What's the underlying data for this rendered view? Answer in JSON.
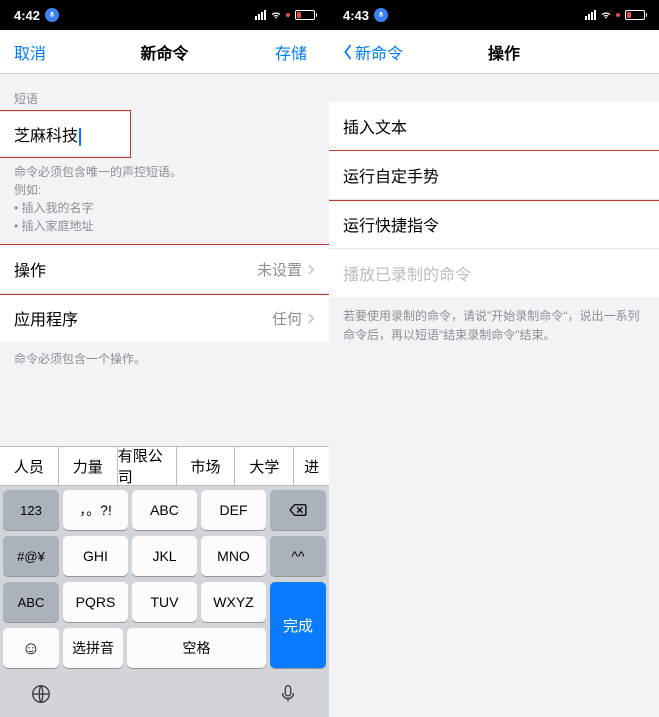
{
  "left": {
    "status": {
      "time": "4:42"
    },
    "nav": {
      "cancel": "取消",
      "title": "新命令",
      "save": "存储"
    },
    "section_label": "短语",
    "input_value": "芝麻科技",
    "help": {
      "line1": "命令必须包含唯一的声控短语。",
      "line2": "例如:",
      "bullet1": "• 插入我的名字",
      "bullet2": "• 插入家庭地址"
    },
    "rows": {
      "action": {
        "label": "操作",
        "value": "未设置"
      },
      "app": {
        "label": "应用程序",
        "value": "任何"
      }
    },
    "footer": "命令必须包含一个操作。",
    "keyboard": {
      "suggestions": [
        "人员",
        "力量",
        "有限公司",
        "市场",
        "大学",
        "进"
      ],
      "r1": {
        "k1": "123",
        "k2": "，。?!",
        "k3": "ABC",
        "k4": "DEF"
      },
      "r2": {
        "k1": "#@¥",
        "k2": "GHI",
        "k3": "JKL",
        "k4": "MNO",
        "k5": "^^"
      },
      "r3": {
        "k1": "ABC",
        "k2": "PQRS",
        "k3": "TUV",
        "k4": "WXYZ"
      },
      "r4": {
        "pinyin": "选拼音",
        "space": "空格",
        "done": "完成"
      }
    }
  },
  "right": {
    "status": {
      "time": "4:43"
    },
    "nav": {
      "back": "新命令",
      "title": "操作"
    },
    "items": {
      "insert": "插入文本",
      "gesture": "运行自定手势",
      "shortcut": "运行快捷指令",
      "recorded": "播放已录制的命令"
    },
    "info": "若要使用录制的命令，请说\"开始录制命令\"，说出一系列命令后，再以短语\"结束录制命令\"结束。"
  }
}
